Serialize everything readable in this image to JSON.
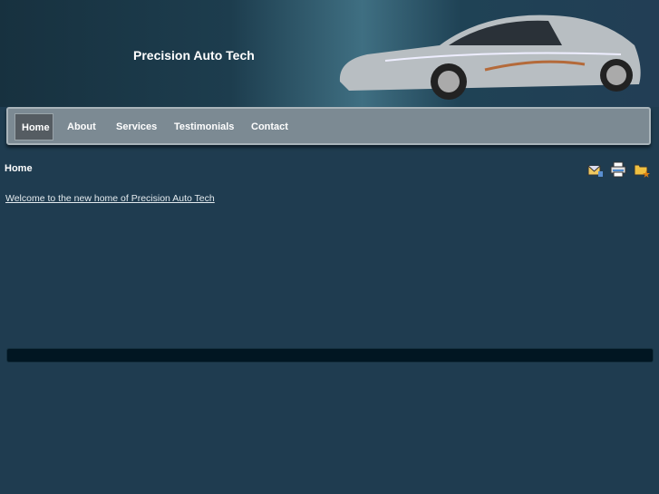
{
  "header": {
    "title": "Precision Auto Tech"
  },
  "nav": {
    "items": [
      {
        "label": "Home"
      },
      {
        "label": "About"
      },
      {
        "label": "Services"
      },
      {
        "label": "Testimonials"
      },
      {
        "label": "Contact"
      }
    ],
    "active": "Home"
  },
  "breadcrumb": "Home",
  "content": {
    "welcome_link": "Welcome to the new home of Precision Auto Tech"
  },
  "icons": [
    "email-icon",
    "print-icon",
    "bookmark-folder-icon"
  ]
}
